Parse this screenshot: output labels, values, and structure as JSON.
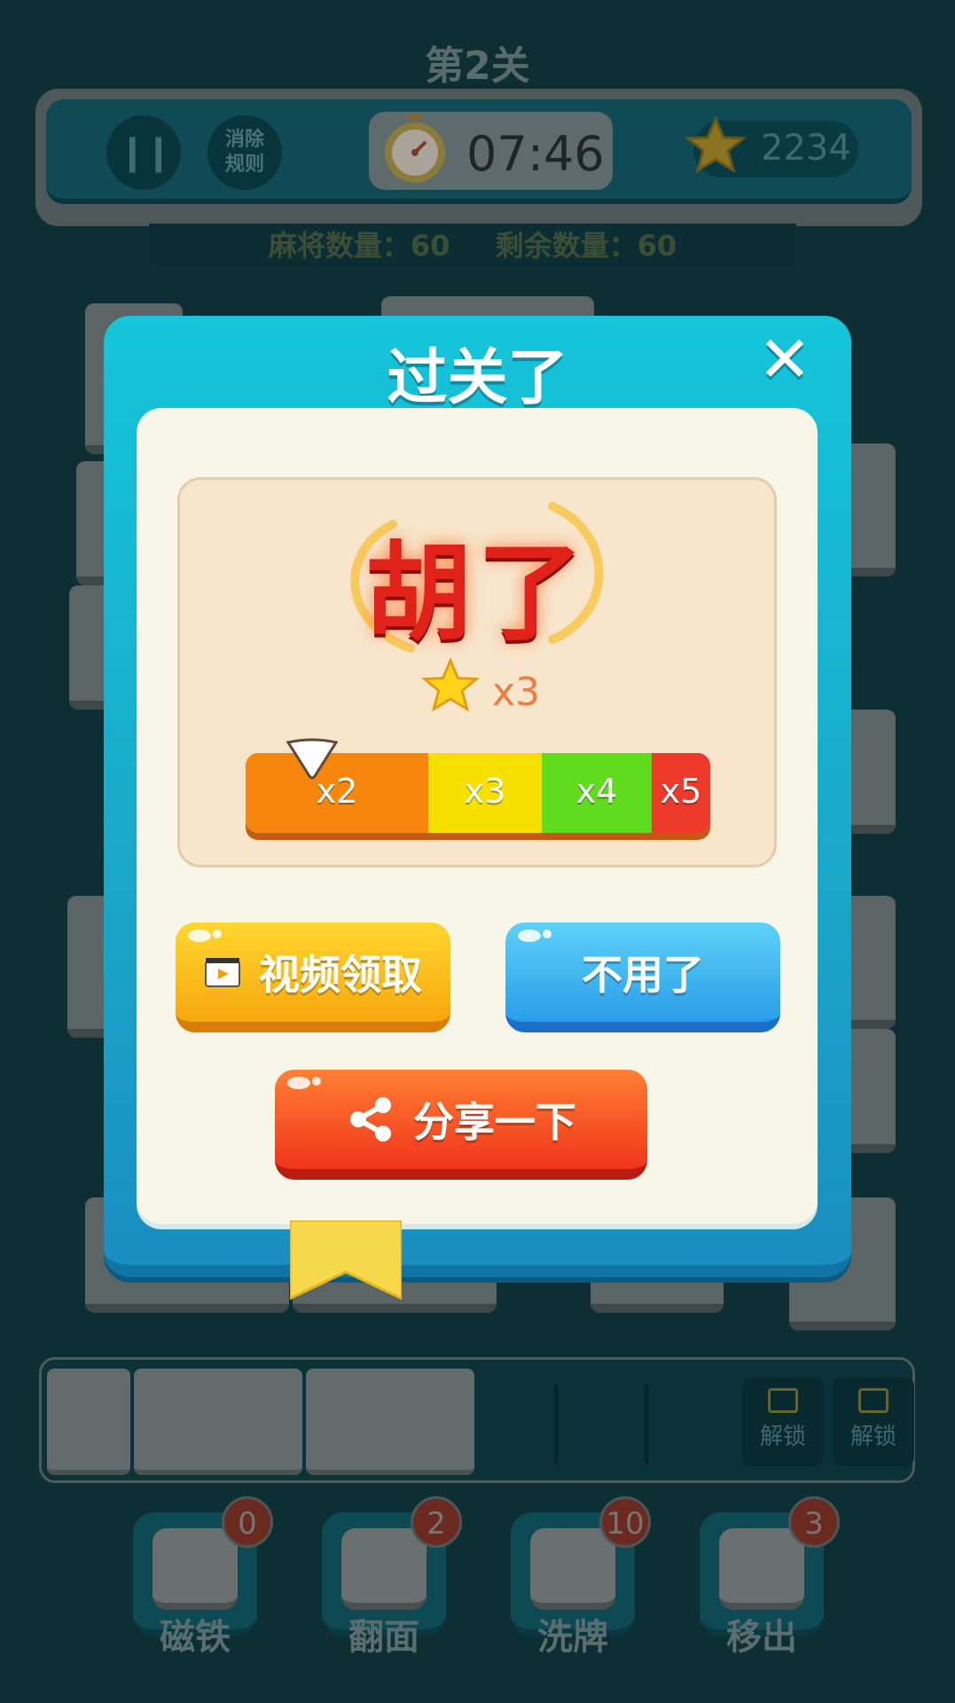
{
  "header": {
    "level_title": "第2关",
    "rules_label_line1": "消除",
    "rules_label_line2": "规则",
    "timer": "07:46",
    "coins": "2234"
  },
  "counts": {
    "mahjong_count": "麻将数量：60",
    "remaining_count": "剩余数量：60"
  },
  "slot_bar": {
    "unlock_label_1": "解锁",
    "unlock_label_2": "解锁"
  },
  "tools": [
    {
      "label": "磁铁",
      "badge": "0"
    },
    {
      "label": "翻面",
      "badge": "2"
    },
    {
      "label": "洗牌",
      "badge": "10"
    },
    {
      "label": "移出",
      "badge": "3"
    }
  ],
  "modal": {
    "title": "过关了",
    "close_symbol": "✕",
    "banner": "胡了",
    "reward_multiplier": "x3",
    "multiplier_bar": [
      "x2",
      "x3",
      "x4",
      "x5"
    ],
    "multiplier_colors": [
      "#f7860f",
      "#f5e000",
      "#5fdc1e",
      "#ee3a2a"
    ],
    "pointer_position": 0.1,
    "video_button": "视频领取",
    "skip_button": "不用了",
    "share_button": "分享一下"
  }
}
